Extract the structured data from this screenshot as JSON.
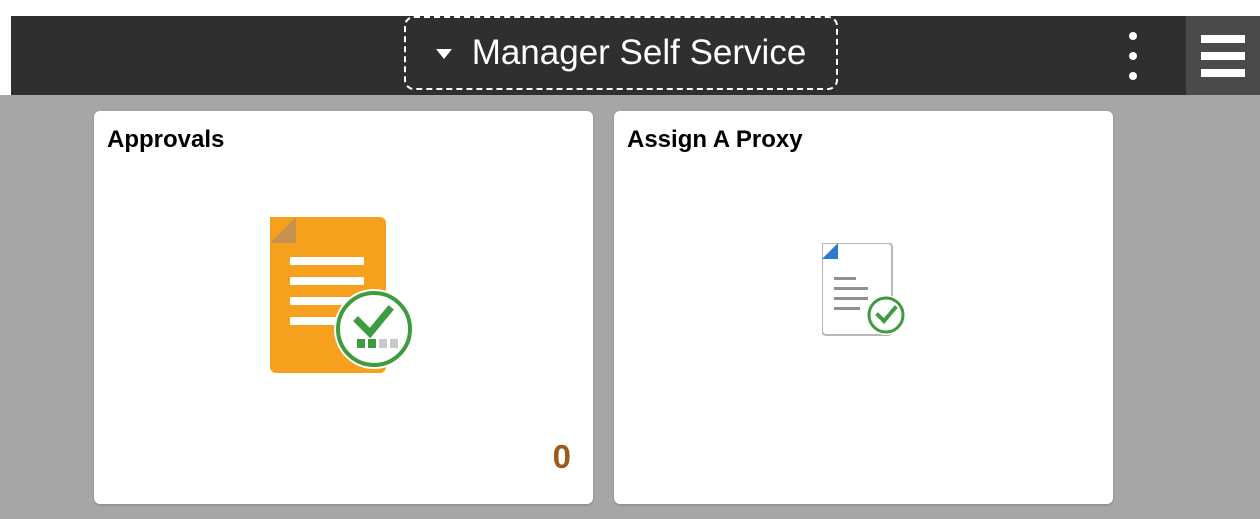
{
  "header": {
    "title": "Manager Self Service"
  },
  "tiles": [
    {
      "title": "Approvals",
      "count": "0"
    },
    {
      "title": "Assign A Proxy"
    }
  ],
  "colors": {
    "header_bg": "#2f2f2f",
    "page_bg": "#a6a6a6",
    "tile_bg": "#ffffff",
    "count_text": "#9c5a1c",
    "approval_orange": "#f7a01d",
    "check_green": "#3e9b3f"
  },
  "icons": {
    "nav_caret": "caret-down-icon",
    "actions": "kebab-menu-icon",
    "menu": "hamburger-menu-icon",
    "approvals": "document-approval-icon",
    "proxy": "document-check-icon"
  }
}
